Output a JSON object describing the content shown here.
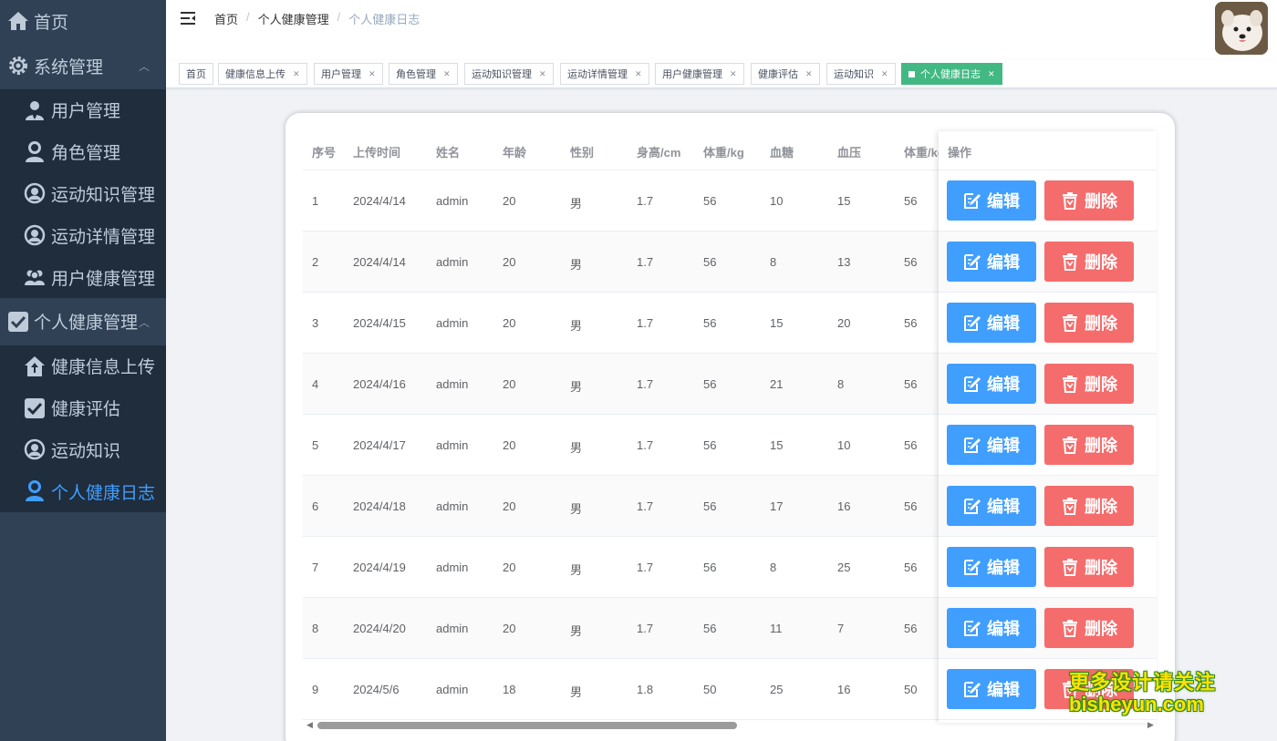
{
  "sidebar": {
    "home": "首页",
    "groups": [
      {
        "label": "系统管理",
        "items": [
          "用户管理",
          "角色管理",
          "运动知识管理",
          "运动详情管理",
          "用户健康管理"
        ]
      },
      {
        "label": "个人健康管理",
        "items": [
          "健康信息上传",
          "健康评估",
          "运动知识",
          "个人健康日志"
        ]
      }
    ],
    "active_item": "个人健康日志",
    "colors": {
      "bg": "#304156",
      "submenu_bg": "#1f2d3d",
      "text": "#bfcbd9",
      "active": "#409eff"
    }
  },
  "header": {
    "breadcrumb": [
      "首页",
      "个人健康管理",
      "个人健康日志"
    ]
  },
  "tags": [
    {
      "label": "首页",
      "closable": false
    },
    {
      "label": "健康信息上传",
      "closable": true
    },
    {
      "label": "用户管理",
      "closable": true
    },
    {
      "label": "角色管理",
      "closable": true
    },
    {
      "label": "运动知识管理",
      "closable": true
    },
    {
      "label": "运动详情管理",
      "closable": true
    },
    {
      "label": "用户健康管理",
      "closable": true
    },
    {
      "label": "健康评估",
      "closable": true
    },
    {
      "label": "运动知识",
      "closable": true
    },
    {
      "label": "个人健康日志",
      "closable": true,
      "active": true
    }
  ],
  "table": {
    "columns": [
      "序号",
      "上传时间",
      "姓名",
      "年龄",
      "性别",
      "身高/cm",
      "体重/kg",
      "血糖",
      "血压",
      "体重/kg"
    ],
    "ops_header": "操作",
    "rows": [
      [
        "1",
        "2024/4/14",
        "admin",
        "20",
        "男",
        "1.7",
        "56",
        "10",
        "15",
        "56"
      ],
      [
        "2",
        "2024/4/14",
        "admin",
        "20",
        "男",
        "1.7",
        "56",
        "8",
        "13",
        "56"
      ],
      [
        "3",
        "2024/4/15",
        "admin",
        "20",
        "男",
        "1.7",
        "56",
        "15",
        "20",
        "56"
      ],
      [
        "4",
        "2024/4/16",
        "admin",
        "20",
        "男",
        "1.7",
        "56",
        "21",
        "8",
        "56"
      ],
      [
        "5",
        "2024/4/17",
        "admin",
        "20",
        "男",
        "1.7",
        "56",
        "15",
        "10",
        "56"
      ],
      [
        "6",
        "2024/4/18",
        "admin",
        "20",
        "男",
        "1.7",
        "56",
        "17",
        "16",
        "56"
      ],
      [
        "7",
        "2024/4/19",
        "admin",
        "20",
        "男",
        "1.7",
        "56",
        "8",
        "25",
        "56"
      ],
      [
        "8",
        "2024/4/20",
        "admin",
        "20",
        "男",
        "1.7",
        "56",
        "11",
        "7",
        "56"
      ],
      [
        "9",
        "2024/5/6",
        "admin",
        "18",
        "男",
        "1.8",
        "50",
        "25",
        "16",
        "50"
      ]
    ],
    "edit_label": "编辑",
    "delete_label": "删除",
    "colors": {
      "edit": "#409eff",
      "delete": "#f56c6c"
    }
  },
  "watermark": {
    "line1": "更多设计请关注",
    "line2": "bisheyun.com"
  }
}
